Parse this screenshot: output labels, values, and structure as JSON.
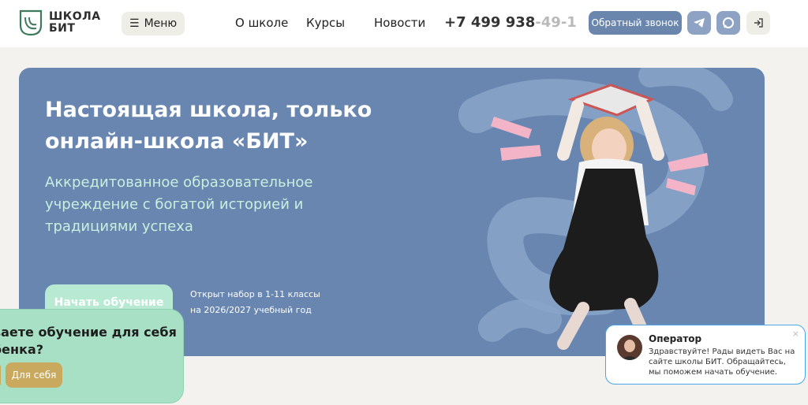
{
  "header": {
    "logo_line1": "ШКОЛА",
    "logo_line2": "БИТ",
    "menu_label": "Меню",
    "nav": [
      "О школе",
      "Курсы",
      "Новости"
    ],
    "phone_main": "+7 499 938",
    "phone_faded": "-49-1",
    "callback_label": "Обратный звонок",
    "icons": [
      "telegram-icon",
      "chat-icon",
      "login-icon"
    ]
  },
  "hero": {
    "title": "Настоящая школа, только онлайн-школа «БИТ»",
    "subtitle": "Аккредитованное образовательное учреждение с богатой историей и традициями успеха",
    "start_label": "Начать обучение",
    "enroll_line1": "Открыт набор в 1-11 классы",
    "enroll_line2": "на 2026/2027 учебный год"
  },
  "popup": {
    "question_line1": "ваете обучение для себя",
    "question_line2": "бенка?",
    "self_label": "Для себя"
  },
  "chat": {
    "operator": "Оператор",
    "message": "Здравствуйте! Рады видеть Вас на сайте школы БИТ. Обращайтесь, мы поможем начать обучение.",
    "close": "×"
  },
  "colors": {
    "hero_bg": "#6886b0",
    "accent_green": "#b8ead3",
    "callback_bg": "#6b86ac",
    "popup_bg": "#a8e0c6",
    "gold": "#c8a95e",
    "chat_border": "#4aa6e8"
  }
}
